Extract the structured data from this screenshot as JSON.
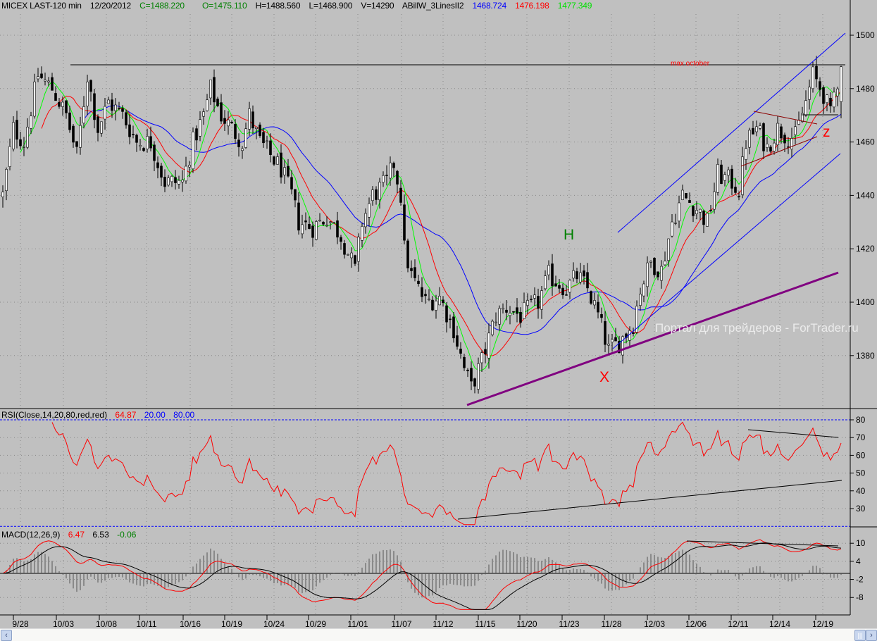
{
  "header": {
    "symbol": "MICEX LAST-120 min",
    "date": "12/20/2012",
    "close": "C=1488.220",
    "open": "O=1475.110",
    "high": "H=1488.560",
    "low": "L=1468.900",
    "volume": "V=14290",
    "indicator": "ABillW_3LinesII2",
    "line_blue": "1468.724",
    "line_red": "1476.198",
    "line_green": "1477.349"
  },
  "rsi_header": {
    "label": "RSI(Close,14,20,80,red,red)",
    "value": "64.87",
    "low": "20.00",
    "high": "80.00"
  },
  "macd_header": {
    "label": "MACD(12,26,9)",
    "macd": "6.47",
    "signal": "6.53",
    "hist": "-0.06"
  },
  "annotations": {
    "max_label": "max october",
    "h_label": "H",
    "x_label": "X",
    "z_label": "z",
    "watermark": "Портал для трейдеров - ForTrader.ru"
  },
  "colors": {
    "green": "#008000",
    "red": "#ff0000",
    "blue": "#0000ff",
    "lime": "#00ff00",
    "purple": "#800080"
  },
  "chart_data": {
    "type": "candlestick",
    "title": "MICEX LAST-120 min",
    "price_axis": {
      "ticks": [
        "1500",
        "1480",
        "1460",
        "1440",
        "1420",
        "1400",
        "1380"
      ],
      "range": [
        1362,
        1512
      ]
    },
    "rsi_axis": {
      "ticks": [
        "80",
        "70",
        "60",
        "50",
        "40",
        "30"
      ],
      "range": [
        20,
        86
      ]
    },
    "macd_axis": {
      "ticks": [
        "10",
        "4",
        "-2",
        "-8"
      ],
      "range": [
        -12,
        14
      ]
    },
    "x_ticks": [
      "9/28",
      "10/03",
      "10/08",
      "10/11",
      "10/16",
      "10/19",
      "10/24",
      "10/29",
      "11/01",
      "11/07",
      "11/12",
      "11/15",
      "11/20",
      "11/23",
      "11/28",
      "12/03",
      "12/06",
      "12/11",
      "12/14",
      "12/19"
    ],
    "approx_close_path": [
      [
        0,
        1440
      ],
      [
        3,
        1465
      ],
      [
        6,
        1460
      ],
      [
        10,
        1485
      ],
      [
        14,
        1480
      ],
      [
        18,
        1470
      ],
      [
        21,
        1455
      ],
      [
        24,
        1485
      ],
      [
        27,
        1465
      ],
      [
        30,
        1475
      ],
      [
        34,
        1470
      ],
      [
        38,
        1460
      ],
      [
        42,
        1460
      ],
      [
        46,
        1445
      ],
      [
        51,
        1445
      ],
      [
        54,
        1460
      ],
      [
        57,
        1470
      ],
      [
        59,
        1480
      ],
      [
        62,
        1470
      ],
      [
        65,
        1465
      ],
      [
        68,
        1460
      ],
      [
        70,
        1470
      ],
      [
        73,
        1460
      ],
      [
        76,
        1455
      ],
      [
        79,
        1450
      ],
      [
        82,
        1440
      ],
      [
        84,
        1430
      ],
      [
        88,
        1428
      ],
      [
        92,
        1432
      ],
      [
        96,
        1425
      ],
      [
        100,
        1412
      ],
      [
        102,
        1430
      ],
      [
        105,
        1440
      ],
      [
        109,
        1445
      ],
      [
        111,
        1452
      ],
      [
        113,
        1440
      ],
      [
        114,
        1420
      ],
      [
        116,
        1410
      ],
      [
        120,
        1400
      ],
      [
        124,
        1402
      ],
      [
        128,
        1390
      ],
      [
        131,
        1375
      ],
      [
        133,
        1368
      ],
      [
        136,
        1378
      ],
      [
        140,
        1395
      ],
      [
        143,
        1398
      ],
      [
        147,
        1395
      ],
      [
        152,
        1400
      ],
      [
        155,
        1410
      ],
      [
        160,
        1405
      ],
      [
        163,
        1410
      ],
      [
        166,
        1405
      ],
      [
        169,
        1395
      ],
      [
        172,
        1382
      ],
      [
        175,
        1385
      ],
      [
        179,
        1392
      ],
      [
        181,
        1405
      ],
      [
        184,
        1415
      ],
      [
        187,
        1412
      ],
      [
        190,
        1430
      ],
      [
        193,
        1440
      ],
      [
        197,
        1435
      ],
      [
        200,
        1430
      ],
      [
        203,
        1448
      ],
      [
        207,
        1445
      ],
      [
        209,
        1442
      ],
      [
        211,
        1460
      ],
      [
        214,
        1465
      ],
      [
        217,
        1458
      ],
      [
        220,
        1465
      ],
      [
        223,
        1462
      ],
      [
        225,
        1462
      ],
      [
        228,
        1475
      ],
      [
        230,
        1485
      ],
      [
        233,
        1478
      ],
      [
        235,
        1470
      ],
      [
        236,
        1478
      ],
      [
        238,
        1488
      ]
    ],
    "last_bar": {
      "open": 1475.11,
      "high": 1488.56,
      "low": 1468.9,
      "close": 1488.22
    },
    "series": [
      {
        "name": "3Lines blue",
        "last": 1468.724
      },
      {
        "name": "3Lines red",
        "last": 1476.198
      },
      {
        "name": "3Lines green",
        "last": 1477.349
      },
      {
        "name": "RSI(14)",
        "last": 64.87
      },
      {
        "name": "MACD",
        "last": 6.47
      },
      {
        "name": "Signal",
        "last": 6.53
      },
      {
        "name": "Histogram",
        "last": -0.06
      }
    ],
    "levels": {
      "max_october": 1488.5,
      "rsi_low": 20,
      "rsi_high": 80
    }
  }
}
